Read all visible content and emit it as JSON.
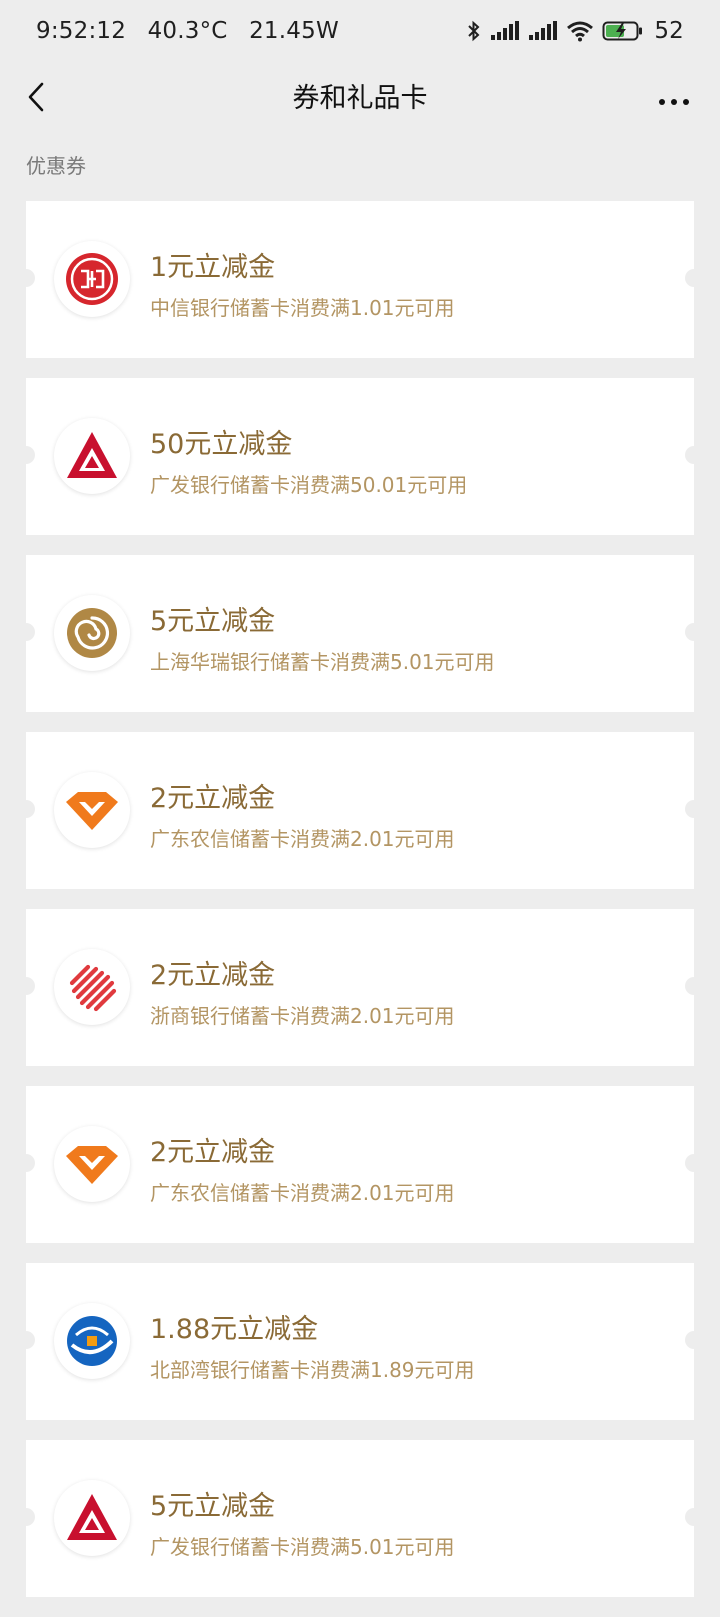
{
  "status_bar": {
    "time": "9:52:12",
    "temperature": "40.3°C",
    "power": "21.45W",
    "battery": "52",
    "icons": [
      "bluetooth-icon",
      "signal-icon",
      "signal-icon",
      "wifi-icon",
      "battery-charging-icon"
    ]
  },
  "nav": {
    "title": "券和礼品卡",
    "back_icon": "chevron-left-icon",
    "more_icon": "more-dots-icon"
  },
  "section": {
    "label": "优惠券"
  },
  "coupons": [
    {
      "title": "1元立减金",
      "desc": "中信银行储蓄卡消费满1.01元可用",
      "logo": "citic-bank-logo"
    },
    {
      "title": "50元立减金",
      "desc": "广发银行储蓄卡消费满50.01元可用",
      "logo": "cgb-bank-logo"
    },
    {
      "title": "5元立减金",
      "desc": "上海华瑞银行储蓄卡消费满5.01元可用",
      "logo": "huarui-bank-logo"
    },
    {
      "title": "2元立减金",
      "desc": "广东农信储蓄卡消费满2.01元可用",
      "logo": "gdrcu-logo"
    },
    {
      "title": "2元立减金",
      "desc": "浙商银行储蓄卡消费满2.01元可用",
      "logo": "czbank-logo"
    },
    {
      "title": "2元立减金",
      "desc": "广东农信储蓄卡消费满2.01元可用",
      "logo": "gdrcu-logo"
    },
    {
      "title": "1.88元立减金",
      "desc": "北部湾银行储蓄卡消费满1.89元可用",
      "logo": "bbw-bank-logo"
    },
    {
      "title": "5元立减金",
      "desc": "广发银行储蓄卡消费满5.01元可用",
      "logo": "cgb-bank-logo"
    }
  ],
  "colors": {
    "background": "#ededed",
    "card": "#ffffff",
    "title_gold": "#8a6a36",
    "desc_gold": "#b39563"
  }
}
